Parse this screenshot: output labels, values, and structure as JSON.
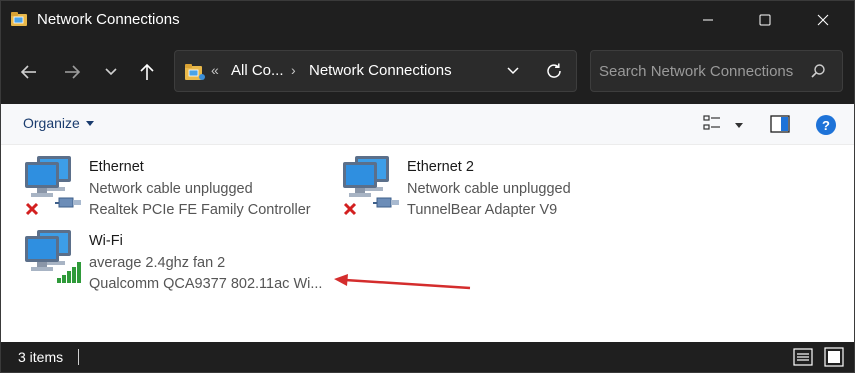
{
  "window": {
    "title": "Network Connections",
    "icon": "network-folder-icon"
  },
  "address_bar": {
    "overflow": "«",
    "segments": [
      "All Co...",
      "Network Connections"
    ],
    "separator": "›"
  },
  "search": {
    "placeholder": "Search Network Connections",
    "value": ""
  },
  "command_bar": {
    "organize_label": "Organize"
  },
  "connections": [
    {
      "name": "Ethernet",
      "status": "Network cable unplugged",
      "device": "Realtek PCIe FE Family Controller",
      "badge": "red-x-icon"
    },
    {
      "name": "Ethernet 2",
      "status": "Network cable unplugged",
      "device": "TunnelBear Adapter V9",
      "badge": "red-x-icon"
    },
    {
      "name": "Wi-Fi",
      "status": "average 2.4ghz fan 2",
      "device": "Qualcomm QCA9377 802.11ac Wi...",
      "badge": "signal-bars-icon"
    }
  ],
  "status_bar": {
    "item_count": "3 items"
  },
  "colors": {
    "chrome": "#1f1f1f",
    "accent": "#1e73d8",
    "annotation_arrow": "#d42d2d",
    "error": "#d32020",
    "signal": "#2f9a3a"
  }
}
